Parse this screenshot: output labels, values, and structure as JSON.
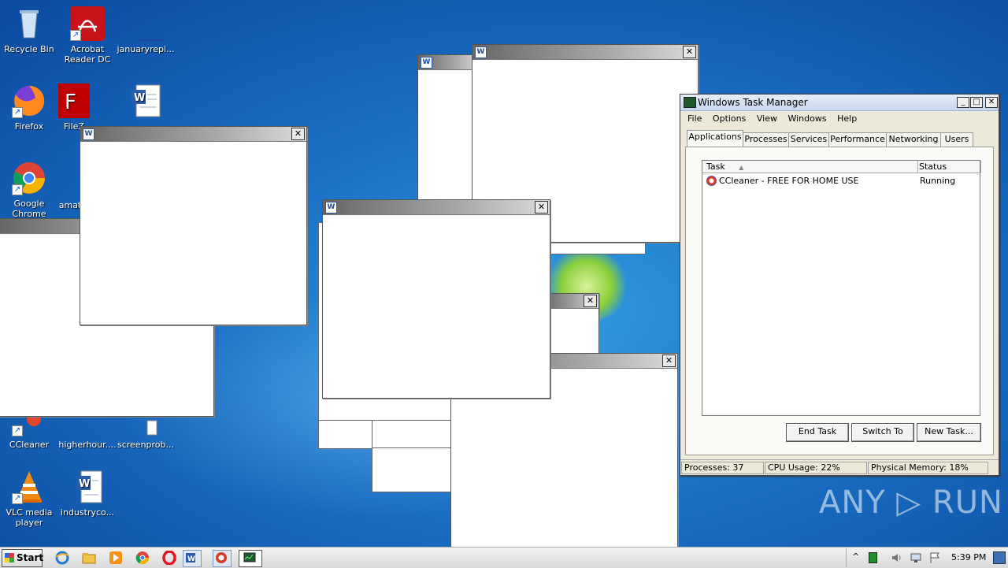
{
  "desktop": {
    "icons": [
      {
        "label": "Recycle Bin",
        "icon": "recycle-bin-icon"
      },
      {
        "label": "Acrobat Reader DC",
        "icon": "acrobat-icon"
      },
      {
        "label": "januaryrepl...",
        "icon": "word-doc-icon"
      },
      {
        "label": "Firefox",
        "icon": "firefox-icon"
      },
      {
        "label": "FileZ",
        "icon": "filezilla-icon"
      },
      {
        "label": "Google Chrome",
        "icon": "chrome-icon"
      },
      {
        "label": "amat",
        "icon": "word-doc-icon"
      },
      {
        "label": "CCleaner",
        "icon": "ccleaner-icon"
      },
      {
        "label": "higherhour....",
        "icon": "word-doc-icon"
      },
      {
        "label": "screenprob...",
        "icon": "word-doc-icon"
      },
      {
        "label": "VLC media player",
        "icon": "vlc-icon"
      },
      {
        "label": "industryco...",
        "icon": "word-doc-icon"
      }
    ]
  },
  "windows": {
    "close_glyph": "✕",
    "word_glyph": "W"
  },
  "task_manager": {
    "title": "Windows Task Manager",
    "controls": {
      "minimize": "_",
      "maximize": "□",
      "close": "✕"
    },
    "menu": [
      "File",
      "Options",
      "View",
      "Windows",
      "Help"
    ],
    "tabs": [
      "Applications",
      "Processes",
      "Services",
      "Performance",
      "Networking",
      "Users"
    ],
    "active_tab": "Applications",
    "columns": {
      "task": "Task",
      "status": "Status",
      "sort_glyph": "▲"
    },
    "rows": [
      {
        "task": "CCleaner - FREE FOR HOME USE",
        "status": "Running"
      }
    ],
    "buttons": {
      "end_task": "End Task",
      "switch_to": "Switch To",
      "new_task": "New Task..."
    },
    "status_bar": {
      "processes": "Processes: 37",
      "cpu": "CPU Usage: 22%",
      "memory": "Physical Memory: 18%"
    }
  },
  "taskbar": {
    "start_label": "Start",
    "clock": "5:39 PM",
    "tray_expand": "^"
  },
  "watermark": "ANY ▷ RUN"
}
